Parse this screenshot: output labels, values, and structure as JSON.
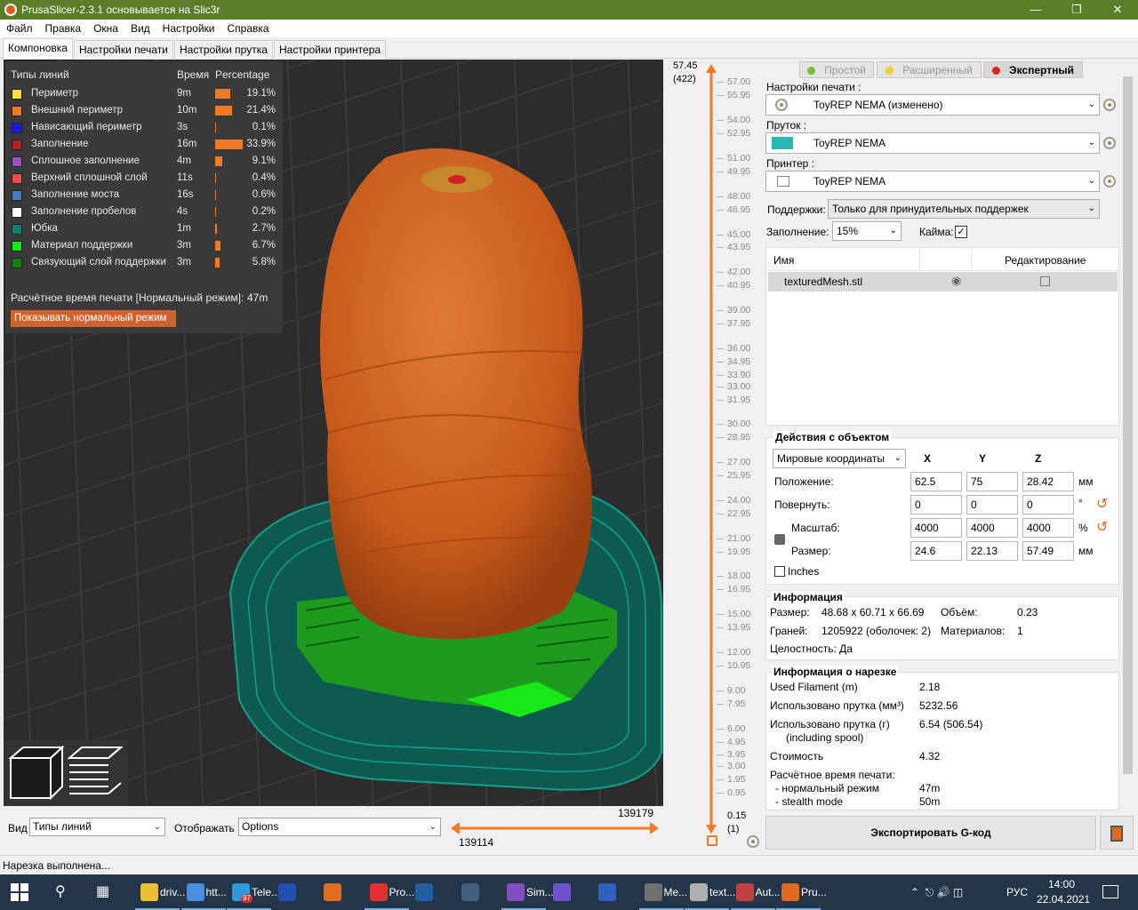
{
  "window": {
    "title": "PrusaSlicer-2.3.1 основывается на Slic3r"
  },
  "menu": [
    "Файл",
    "Правка",
    "Окна",
    "Вид",
    "Настройки",
    "Справка"
  ],
  "tabs": [
    "Компоновка",
    "Настройки печати",
    "Настройки прутка",
    "Настройки принтера"
  ],
  "legend": {
    "header_type": "Типы линий",
    "header_time": "Время",
    "header_pct": "Percentage",
    "rows": [
      {
        "label": "Периметр",
        "time": "9m",
        "pct": "19.1%",
        "fraction": 0.191,
        "color": "#ffe043"
      },
      {
        "label": "Внешний периметр",
        "time": "10m",
        "pct": "21.4%",
        "fraction": 0.214,
        "color": "#f07a28"
      },
      {
        "label": "Нависающий периметр",
        "time": "3s",
        "pct": "0.1%",
        "fraction": 0.001,
        "color": "#1a1ae8"
      },
      {
        "label": "Заполнение",
        "time": "16m",
        "pct": "33.9%",
        "fraction": 0.339,
        "color": "#b02020"
      },
      {
        "label": "Сплошное заполнение",
        "time": "4m",
        "pct": "9.1%",
        "fraction": 0.091,
        "color": "#9a50c8"
      },
      {
        "label": "Верхний сплошной слой",
        "time": "11s",
        "pct": "0.4%",
        "fraction": 0.004,
        "color": "#f04848"
      },
      {
        "label": "Заполнение моста",
        "time": "16s",
        "pct": "0.6%",
        "fraction": 0.006,
        "color": "#4a7ac8"
      },
      {
        "label": "Заполнение пробелов",
        "time": "4s",
        "pct": "0.2%",
        "fraction": 0.002,
        "color": "#ffffff"
      },
      {
        "label": "Юбка",
        "time": "1m",
        "pct": "2.7%",
        "fraction": 0.027,
        "color": "#0a8070"
      },
      {
        "label": "Материал поддержки",
        "time": "3m",
        "pct": "6.7%",
        "fraction": 0.067,
        "color": "#18e818"
      },
      {
        "label": "Связующий слой поддержки",
        "time": "3m",
        "pct": "5.8%",
        "fraction": 0.058,
        "color": "#108010"
      }
    ],
    "estimated_label": "Расчётное время печати [Нормальный режим]:",
    "estimated_value": "47m",
    "show_mode_button": "Показывать нормальный режим"
  },
  "bottom": {
    "view_label": "Вид",
    "view_value": "Типы линий",
    "show_label": "Отображать",
    "show_value": "Options",
    "h_slider_right": "139179",
    "h_slider_left": "139114"
  },
  "vslider": {
    "top_value": "57.45",
    "top_layer": "(422)",
    "bottom_value": "0.15",
    "bottom_layer": "(1)",
    "ticks": [
      "57.00",
      "55.95",
      "54.00",
      "52.95",
      "51.00",
      "49.95",
      "48.00",
      "46.95",
      "45.00",
      "43.95",
      "42.00",
      "40.95",
      "39.00",
      "37.95",
      "36.00",
      "34.95",
      "33.90",
      "33.00",
      "31.95",
      "30.00",
      "28.95",
      "27.00",
      "25.95",
      "24.00",
      "22.95",
      "21.00",
      "19.95",
      "18.00",
      "16.95",
      "15.00",
      "13.95",
      "12.00",
      "10.95",
      "9.00",
      "7.95",
      "6.00",
      "4.95",
      "3.95",
      "3.00",
      "1.95",
      "0.95"
    ]
  },
  "modes": {
    "simple": "Простой",
    "advanced": "Расширенный",
    "expert": "Экспертный",
    "simple_color": "#70c030",
    "advanced_color": "#f0d020",
    "expert_color": "#e02020"
  },
  "presets": {
    "print_label": "Настройки печати :",
    "print_value": "ToyREP NEMA (изменено)",
    "filament_label": "Пруток :",
    "filament_value": "ToyREP NEMA",
    "filament_color": "#2ab5b0",
    "printer_label": "Принтер :",
    "printer_value": "ToyREP NEMA",
    "supports_label": "Поддержки:",
    "supports_value": "Только для принудительных поддержек",
    "infill_label": "Заполнение:",
    "infill_value": "15%",
    "brim_label": "Кайма:",
    "brim_checked": true
  },
  "object_list": {
    "col_name": "Имя",
    "col_edit": "Редактирование",
    "items": [
      {
        "name": "texturedMesh.stl"
      }
    ]
  },
  "manipulation": {
    "title": "Действия с объектом",
    "coords": "Мировые координаты",
    "x": "X",
    "y": "Y",
    "z": "Z",
    "position_label": "Положение:",
    "position": [
      "62.5",
      "75",
      "28.42"
    ],
    "position_unit": "мм",
    "rotate_label": "Повернуть:",
    "rotate": [
      "0",
      "0",
      "0"
    ],
    "rotate_unit": "°",
    "scale_label": "Масштаб:",
    "scale": [
      "4000",
      "4000",
      "4000"
    ],
    "scale_unit": "%",
    "size_label": "Размер:",
    "size": [
      "24.6",
      "22.13",
      "57.49"
    ],
    "size_unit": "мм",
    "inches_label": "Inches"
  },
  "info": {
    "title": "Информация",
    "size_label": "Размер:",
    "size_value": "48.68 x 60.71 x 66.69",
    "volume_label": "Объём:",
    "volume_value": "0.23",
    "facets_label": "Граней:",
    "facets_value": "1205922 (оболочек: 2)",
    "materials_label": "Материалов:",
    "materials_value": "1",
    "manifold": "Целостность: Да"
  },
  "slice_info": {
    "title": "Информация о нарезке",
    "filament_m_label": "Used Filament (m)",
    "filament_m_value": "2.18",
    "filament_mm3_label": "Использовано прутка (мм³)",
    "filament_mm3_value": "5232.56",
    "filament_g_label": "Использовано прутка (г)",
    "filament_g_sub": "(including spool)",
    "filament_g_value": "6.54 (506.54)",
    "cost_label": "Стоимость",
    "cost_value": "4.32",
    "time_label": "Расчётное время печати:",
    "normal_label": "- нормальный режим",
    "normal_value": "47m",
    "stealth_label": "- stealth mode",
    "stealth_value": "50m"
  },
  "export_button": "Экспортировать G-код",
  "status": "Нарезка выполнена...",
  "taskbar": {
    "items": [
      "driv...",
      "htt...",
      "Tele...",
      "",
      "",
      "Pro...",
      "",
      "",
      "Sim...",
      "",
      "",
      "Me...",
      "text...",
      "Aut...",
      "Pru..."
    ],
    "badge": "97",
    "lang": "РУС",
    "time": "14:00",
    "date": "22.04.2021"
  }
}
